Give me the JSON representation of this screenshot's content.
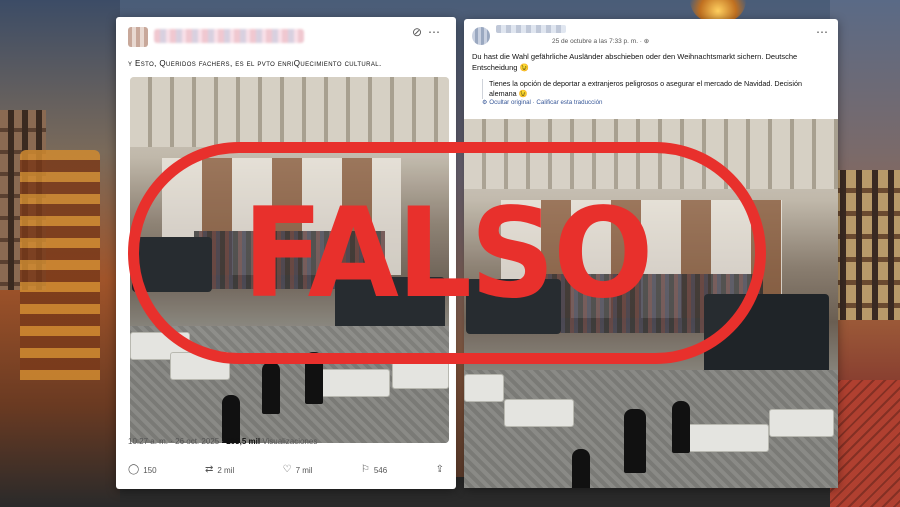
{
  "left_post": {
    "text": "y Esto, Queridos fachers, es el pvto enriQuecimiento cultural.",
    "timestamp": "10:27 a. m. · 26 oct. 2025 · ",
    "views_count": "293,5 mil",
    "views_label": " Visualizaciones",
    "replies": "150",
    "reposts": "2 mil",
    "likes": "7 mil",
    "bookmarks": "546",
    "icons": [
      "reply-icon",
      "repost-icon",
      "heart-icon",
      "bookmark-icon",
      "share-icon"
    ]
  },
  "right_post": {
    "date": "25 de octubre a las 7:33 p. m. · ",
    "text": "Du hast die Wahl gefährliche Ausländer abschieben oder den Weihnachtsmarkt sichern. Deutsche Entscheidung 😉",
    "translation": "Tienes la opción de deportar a extranjeros peligrosos o asegurar el mercado de Navidad. Decisión alemana 😉",
    "hide_original": "Ocultar original",
    "rate_translation": "Calificar esta traducción"
  },
  "stamp": {
    "text": "FALSO",
    "color": "#e8302c"
  }
}
